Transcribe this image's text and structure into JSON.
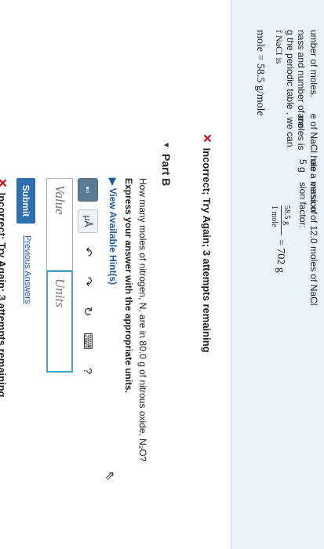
{
  "hint_panel": {
    "lines_col1": [
      "umber of moles.",
      "nass and number of moles is",
      "g the periodic table , we can",
      "f NaCl is"
    ],
    "formula1": "mole = 58.5 g/mole",
    "lines_col2": [
      "e of NaCl has a mass of",
      "are"
    ],
    "lines_col3": [
      "ole",
      "5 g"
    ],
    "lines_col4": [
      "version of 12.0 moles of NaCl",
      "sion factor:"
    ],
    "fraction_num": "58.5 g",
    "fraction_den": "1 mole",
    "fraction_result": "= 702 g"
  },
  "feedback_top": "Incorrect; Try Again; 3 attempts remaining",
  "part_b": {
    "title": "Part B",
    "question": "How many moles of nitrogen, N, are in 80.0 g of nitrous oxide, N₂O?",
    "instruction": "Express your answer with the appropriate units.",
    "hints_link": "View Available Hint(s)"
  },
  "toolbar": {
    "template_label": "▪▫",
    "units_label": "μÅ",
    "undo_icon": "undo-icon",
    "redo_icon": "redo-icon",
    "reset_icon": "reset-icon",
    "keyboard_icon": "keyboard-icon",
    "help_label": "?"
  },
  "inputs": {
    "value_placeholder": "Value",
    "units_placeholder": "Units"
  },
  "submit_label": "Submit",
  "previous_answers_label": "Previous Answers",
  "feedback_bottom": "Incorrect; Try Again; 3 attempts remaining",
  "colors": {
    "error": "#d0021b",
    "link": "#1a5aa8",
    "submit": "#2f6eb1",
    "units_border": "#40a7c9"
  }
}
